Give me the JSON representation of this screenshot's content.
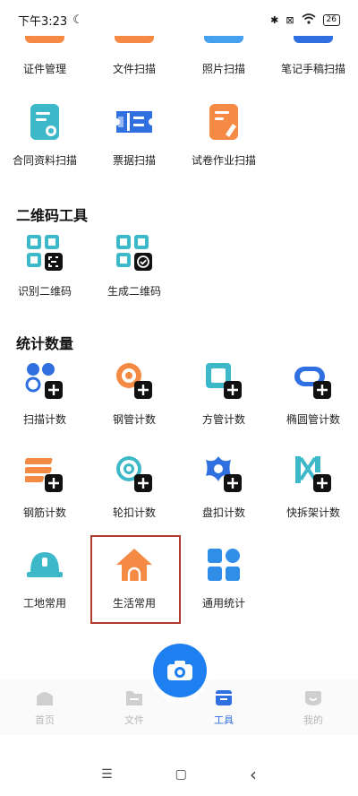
{
  "status_bar": {
    "time": "下午3:23",
    "battery": "26"
  },
  "top_row": [
    {
      "label": "证件管理",
      "icon": "id-card-icon",
      "color": "#f58a44"
    },
    {
      "label": "文件扫描",
      "icon": "file-scan-icon",
      "color": "#f58a44"
    },
    {
      "label": "照片扫描",
      "icon": "photo-scan-icon",
      "color": "#46a0f0"
    },
    {
      "label": "笔记手稿扫描",
      "icon": "note-scan-icon",
      "color": "#2f6fe0"
    }
  ],
  "scan_row": [
    {
      "label": "合同资料扫描",
      "icon": "contract-scan-icon"
    },
    {
      "label": "票据扫描",
      "icon": "receipt-scan-icon"
    },
    {
      "label": "试卷作业扫描",
      "icon": "exam-scan-icon"
    }
  ],
  "qr_section": {
    "title": "二维码工具",
    "items": [
      {
        "label": "识别二维码",
        "icon": "qr-scan-icon"
      },
      {
        "label": "生成二维码",
        "icon": "qr-generate-icon"
      }
    ]
  },
  "count_section": {
    "title": "统计数量",
    "row1": [
      {
        "label": "扫描计数",
        "icon": "scan-count-icon"
      },
      {
        "label": "钢管计数",
        "icon": "steel-pipe-count-icon"
      },
      {
        "label": "方管计数",
        "icon": "square-pipe-count-icon"
      },
      {
        "label": "椭圆管计数",
        "icon": "oval-pipe-count-icon"
      }
    ],
    "row2": [
      {
        "label": "钢筋计数",
        "icon": "rebar-count-icon"
      },
      {
        "label": "轮扣计数",
        "icon": "wheel-buckle-count-icon"
      },
      {
        "label": "盘扣计数",
        "icon": "disc-buckle-count-icon"
      },
      {
        "label": "快拆架计数",
        "icon": "quick-frame-count-icon"
      }
    ],
    "row3": [
      {
        "label": "工地常用",
        "icon": "helmet-icon"
      },
      {
        "label": "生活常用",
        "icon": "house-icon"
      },
      {
        "label": "通用统计",
        "icon": "grid-apps-icon"
      }
    ]
  },
  "tabs": [
    {
      "label": "首页",
      "icon": "home-tab-icon"
    },
    {
      "label": "文件",
      "icon": "folder-tab-icon"
    },
    {
      "label": "工具",
      "icon": "tools-tab-icon"
    },
    {
      "label": "我的",
      "icon": "profile-tab-icon"
    }
  ],
  "camera_button": {
    "icon": "camera-icon"
  },
  "system_nav": {
    "menu": "☰",
    "home": "▢",
    "back": "‹"
  },
  "colors": {
    "accent": "#1e7ff0",
    "orange": "#f58a44",
    "teal": "#3cb8c8",
    "highlight": "#b33a2e"
  }
}
